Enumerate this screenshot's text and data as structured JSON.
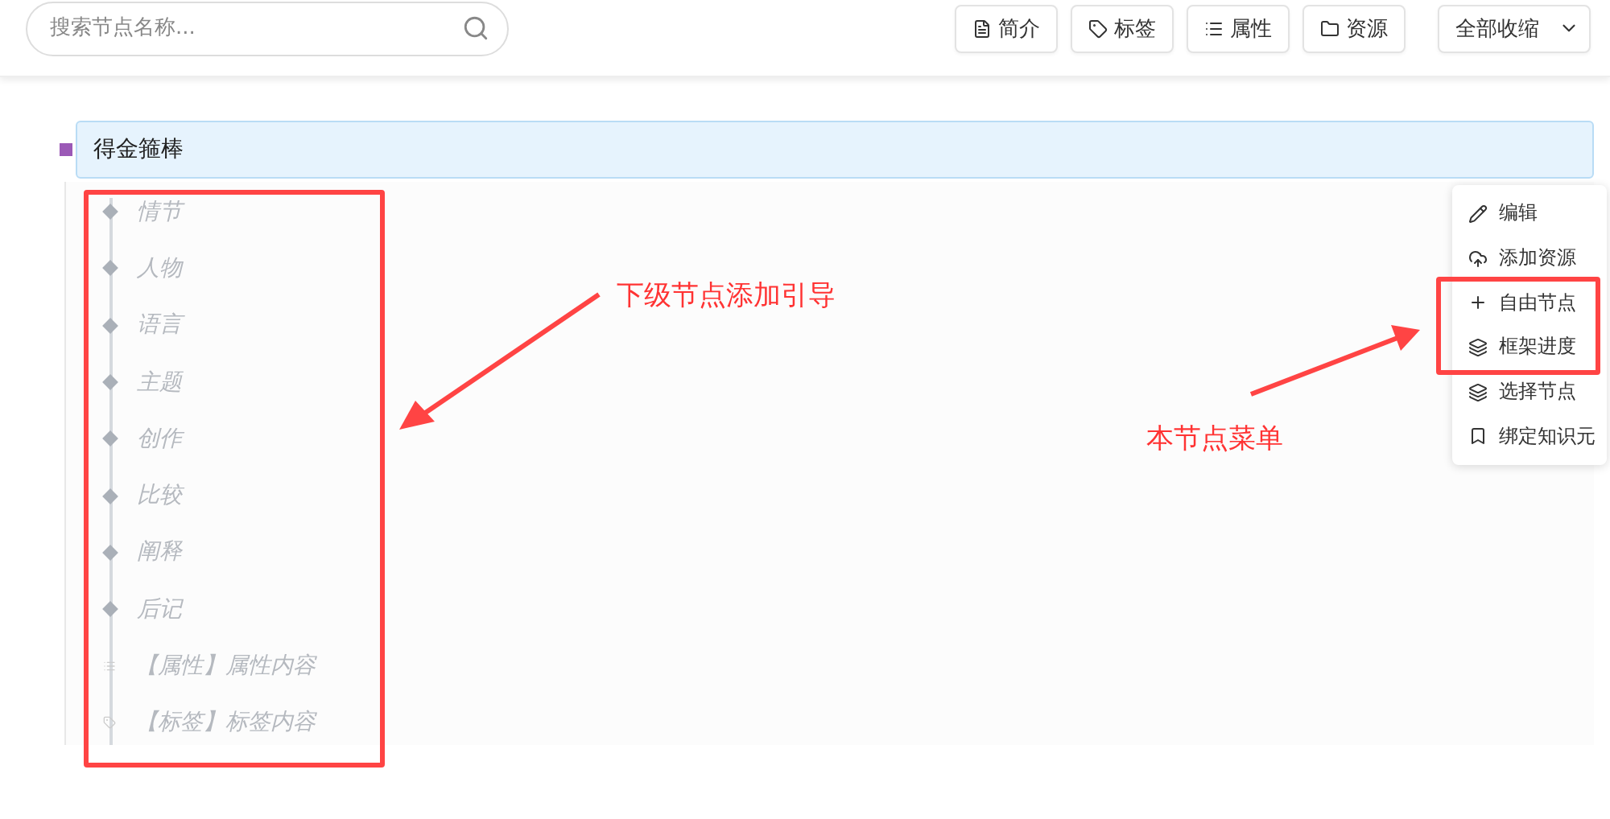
{
  "search": {
    "placeholder": "搜索节点名称..."
  },
  "toolbar": [
    {
      "label": "简介"
    },
    {
      "label": "标签"
    },
    {
      "label": "属性"
    },
    {
      "label": "资源"
    }
  ],
  "collapse_dropdown": {
    "label": "全部收缩"
  },
  "root_node": {
    "label": "得金箍棒",
    "selected": true,
    "color": "#9b59b6"
  },
  "children": [
    {
      "label": "情节",
      "kind": "node"
    },
    {
      "label": "人物",
      "kind": "node"
    },
    {
      "label": "语言",
      "kind": "node"
    },
    {
      "label": "主题",
      "kind": "node"
    },
    {
      "label": "创作",
      "kind": "node"
    },
    {
      "label": "比较",
      "kind": "node"
    },
    {
      "label": "阐释",
      "kind": "node"
    },
    {
      "label": "后记",
      "kind": "node"
    },
    {
      "label": "【属性】属性内容",
      "kind": "attribute"
    },
    {
      "label": "【标签】标签内容",
      "kind": "tag"
    }
  ],
  "context_menu": [
    {
      "label": "编辑"
    },
    {
      "label": "添加资源"
    },
    {
      "label": "自由节点"
    },
    {
      "label": "框架进度"
    },
    {
      "label": "选择节点"
    },
    {
      "label": "绑定知识元"
    }
  ],
  "annotations": [
    {
      "text": "下级节点添加引导"
    },
    {
      "text": "本节点菜单"
    }
  ]
}
